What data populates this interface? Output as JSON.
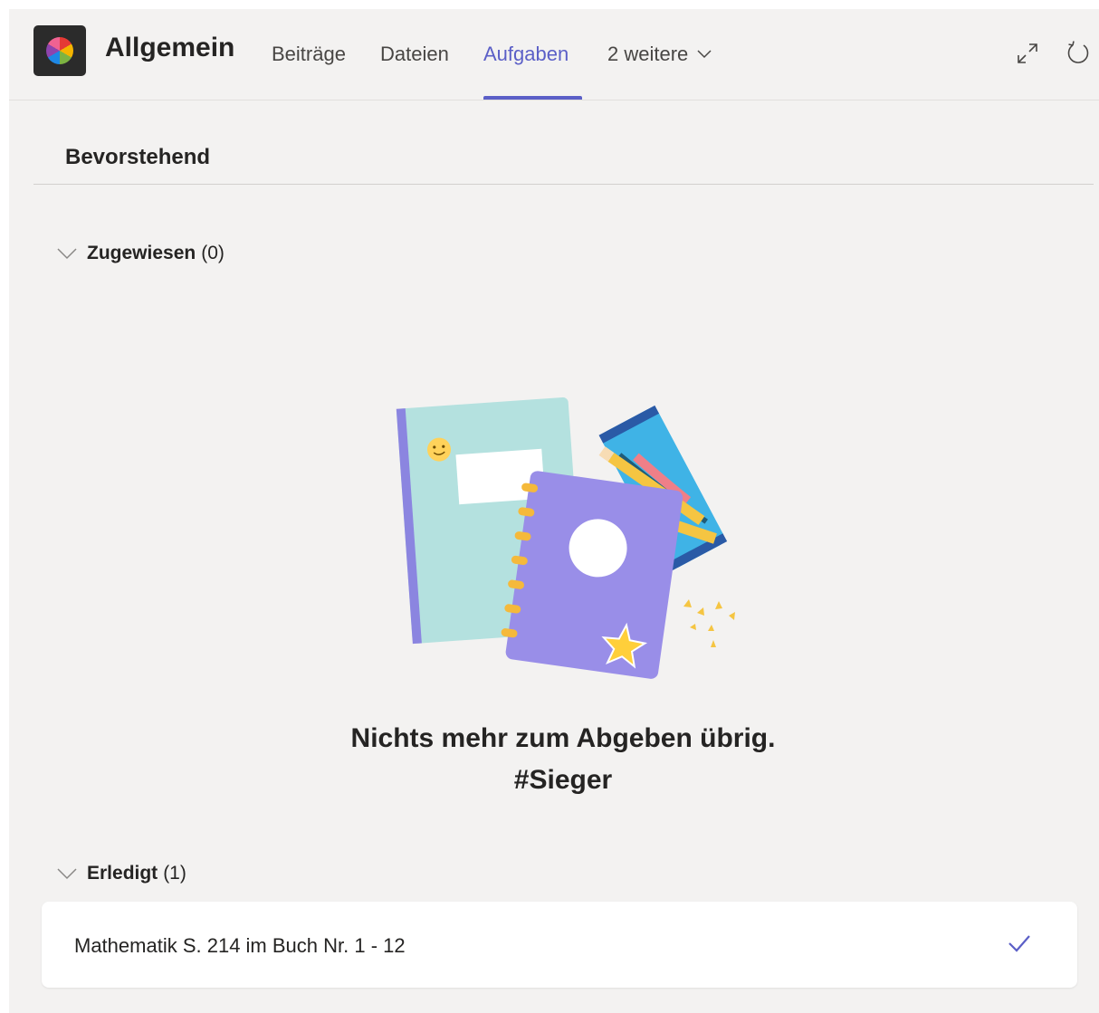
{
  "header": {
    "channel_title": "Allgemein",
    "tabs": [
      {
        "label": "Beiträge",
        "active": false
      },
      {
        "label": "Dateien",
        "active": false
      },
      {
        "label": "Aufgaben",
        "active": true
      },
      {
        "label": "2 weitere",
        "active": false
      }
    ],
    "icons": [
      "expand-icon",
      "refresh-icon"
    ],
    "accent_color": "#5b5fc7"
  },
  "section": {
    "title": "Bevorstehend"
  },
  "groups": {
    "assigned": {
      "label": "Zugewiesen",
      "count": "(0)"
    },
    "done": {
      "label": "Erledigt",
      "count": "(1)"
    }
  },
  "empty_state": {
    "line1": "Nichts mehr zum Abgeben übrig.",
    "line2": "#Sieger"
  },
  "done_tasks": [
    {
      "title": "Mathematik S. 214 im Buch Nr. 1 - 12",
      "status_icon": "checkmark-icon"
    }
  ]
}
